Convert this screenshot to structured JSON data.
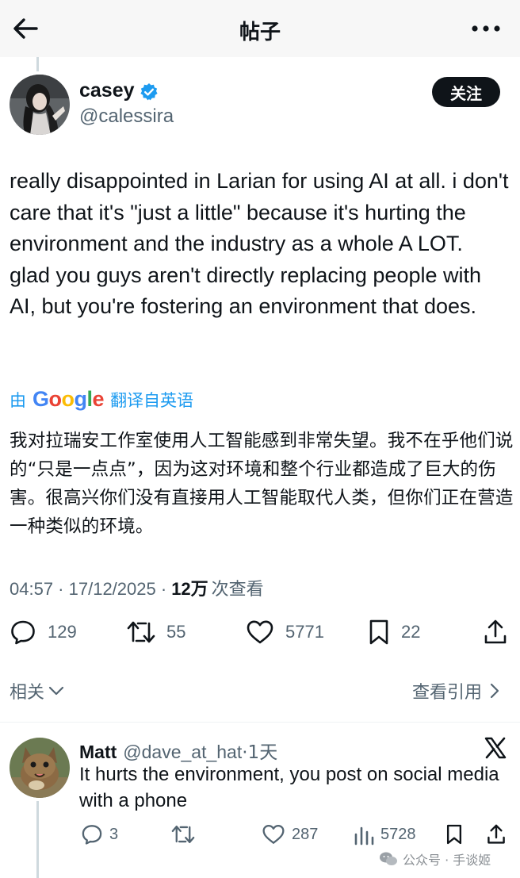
{
  "header": {
    "title": "帖子",
    "back_icon": "arrow-left-icon",
    "more_icon": "more-icon"
  },
  "author": {
    "name": "casey",
    "handle": "@calessira",
    "verified": true,
    "follow_label": "关注"
  },
  "tweet": {
    "text": "really disappointed in Larian for using AI at all. i don't care that it's \"just a little\" because it's hurting the environment and the industry as a whole A LOT. glad you guys aren't directly replacing people with AI, but you're fostering an environment that does.",
    "translated_by_prefix": "由",
    "translated_by_brand": "Google",
    "translated_by_suffix": "翻译自英语",
    "translation": "我对拉瑞安工作室使用人工智能感到非常失望。我不在乎他们说的“只是一点点”，因为这对环境和整个行业都造成了巨大的伤害。很高兴你们没有直接用人工智能取代人类，但你们正在营造一种类似的环境。",
    "time": "04:57",
    "date": "17/12/2025",
    "views_count": "12万",
    "views_label": "次查看"
  },
  "stats": {
    "replies": "129",
    "retweets": "55",
    "likes": "5771",
    "bookmarks": "22"
  },
  "links": {
    "related": "相关",
    "view_quotes": "查看引用"
  },
  "reply": {
    "name": "Matt",
    "handle": "@dave_at_hat",
    "time": "·1天",
    "text": "It hurts the environment, you post on social media with a phone",
    "stats": {
      "replies": "3",
      "likes": "287",
      "views": "5728"
    }
  },
  "watermark": "公众号 · 手谈姬",
  "colors": {
    "accent": "#1d9bf0",
    "text": "#0f1419",
    "muted": "#536471",
    "follow_bg": "#0f1419"
  }
}
